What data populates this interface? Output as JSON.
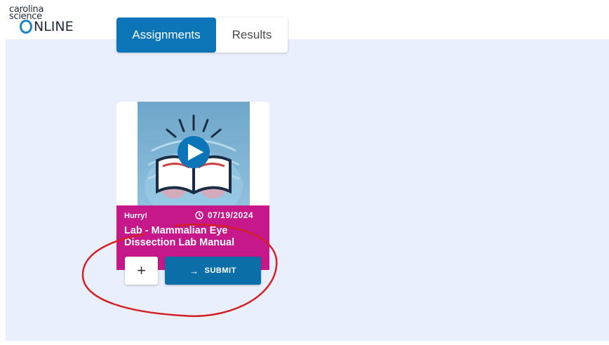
{
  "logo": {
    "line1": "carolina",
    "line2": "science",
    "line3": "NLINE"
  },
  "tabs": [
    {
      "label": "Assignments",
      "active": true
    },
    {
      "label": "Results",
      "active": false
    }
  ],
  "assignment_card": {
    "badge": "Hurry!",
    "due_date": "07/19/2024",
    "title": "Lab - Mammalian Eye Dissection Lab Manual",
    "clock_icon": "clock-icon",
    "thumbnail_icons": [
      "play-icon",
      "book-icon"
    ],
    "add_button_label": "+",
    "submit_label": "SUBMIT",
    "submit_icon": "arrow-right-icon"
  },
  "colors": {
    "primary": "#0b75b8",
    "card_accent": "#c7188b",
    "background": "#eaeffd",
    "annotation": "#d42020"
  }
}
